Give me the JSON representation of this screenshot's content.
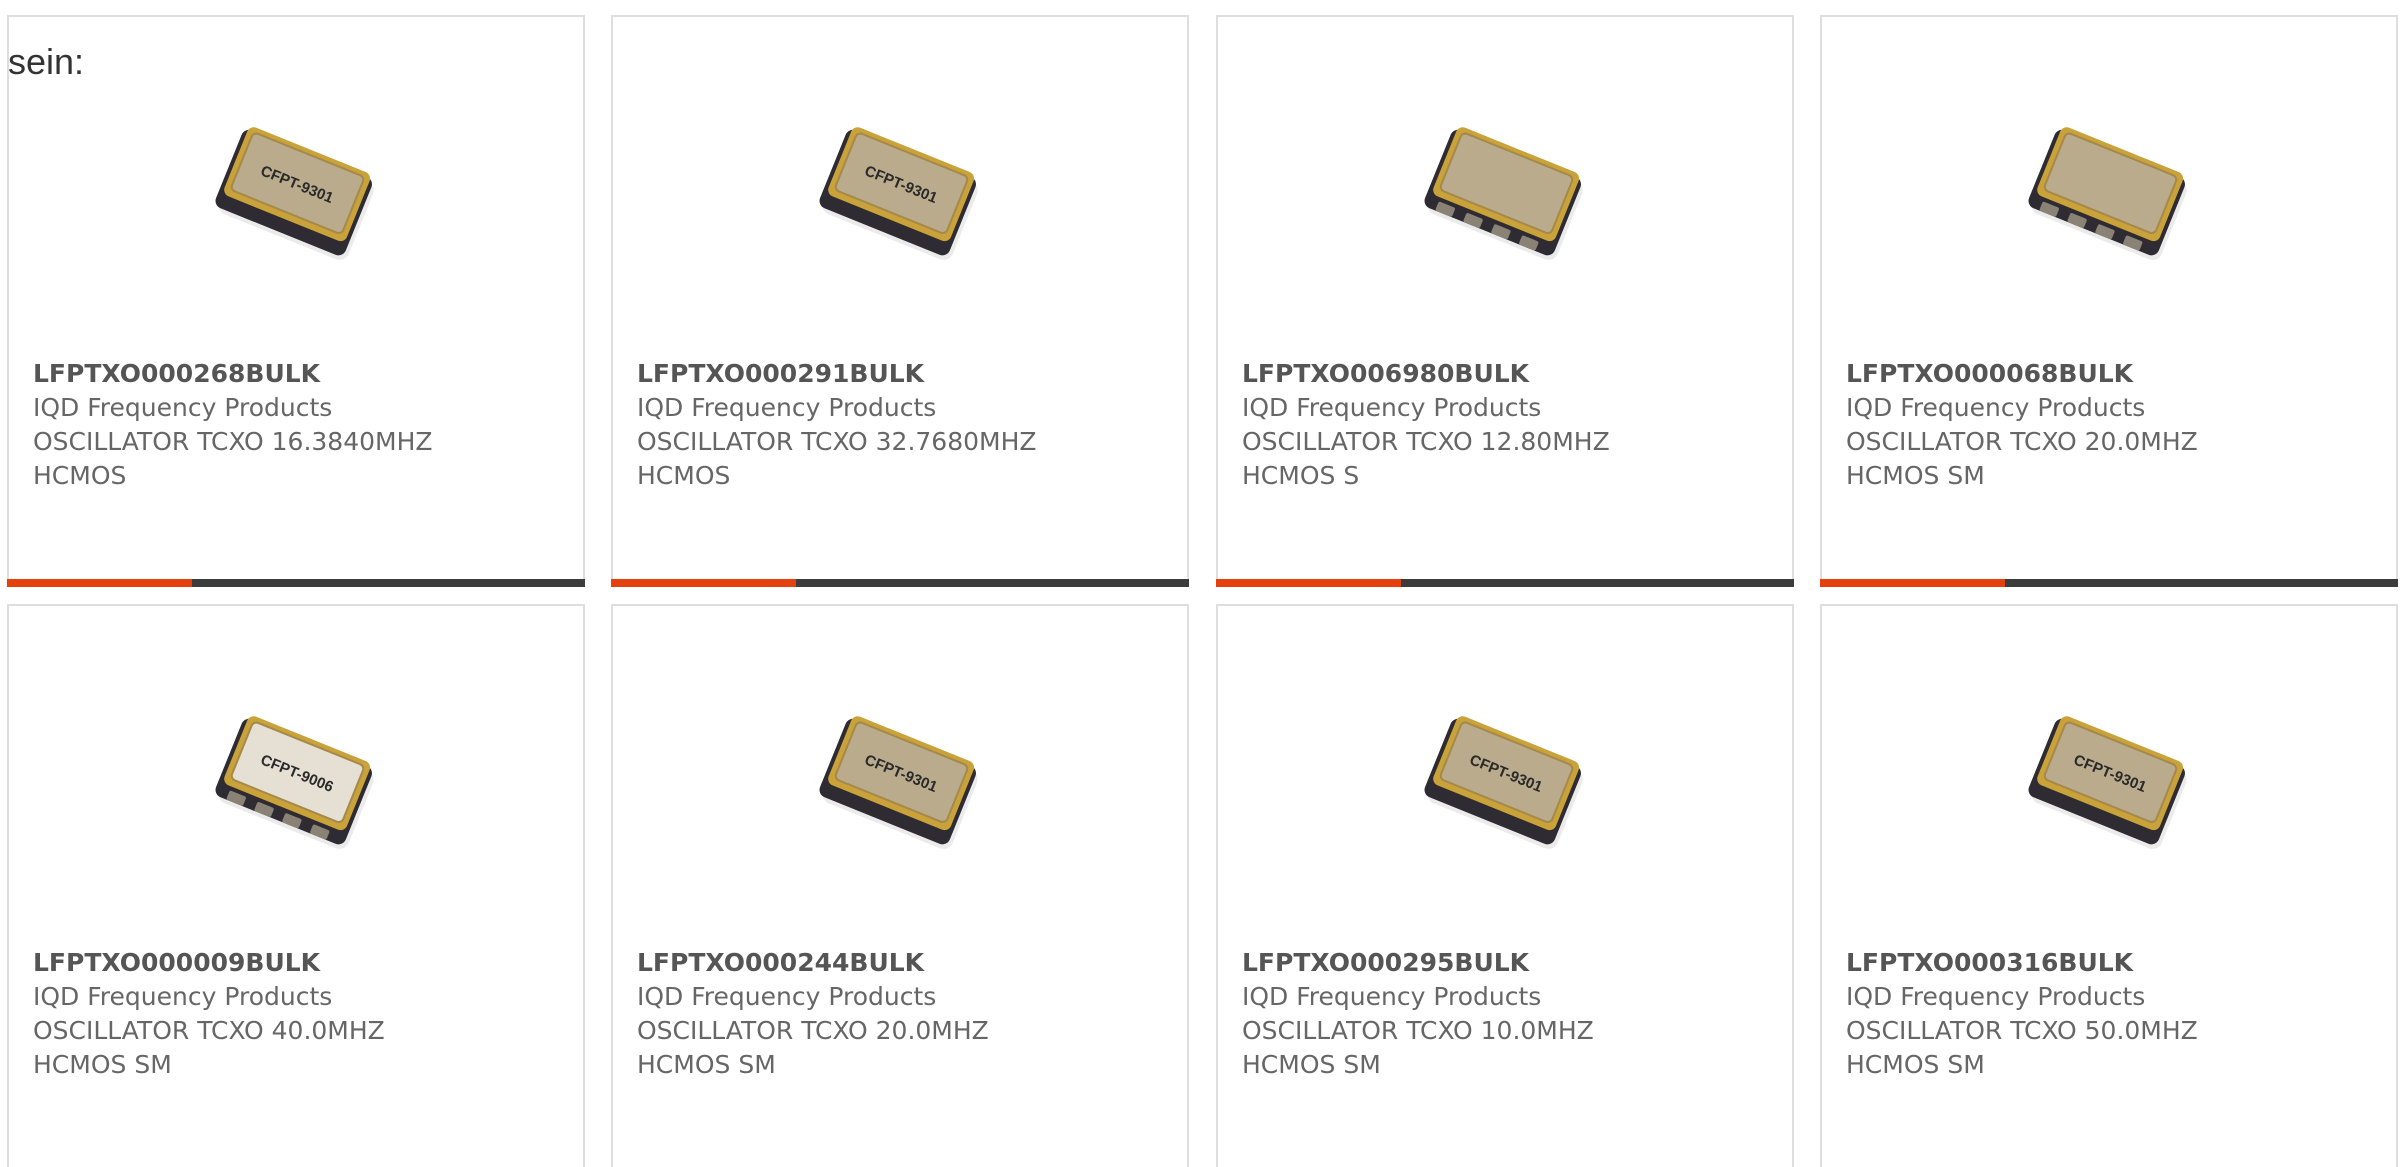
{
  "intro_text": "sein:",
  "colors": {
    "accent": "#e5410f",
    "bar_track": "#3c3c3c",
    "card_border": "#dedede",
    "text": "#666666"
  },
  "products": [
    {
      "part_number": "LFPTXO000268BULK",
      "manufacturer": "IQD Frequency Products",
      "description_line1": "OSCILLATOR TCXO 16.3840MHZ",
      "description_line2": "HCMOS",
      "image_label": "CFPT-9301",
      "image_type": "oscillator-chip-icon",
      "progress": 0.32
    },
    {
      "part_number": "LFPTXO000291BULK",
      "manufacturer": "IQD Frequency Products",
      "description_line1": "OSCILLATOR TCXO 32.7680MHZ",
      "description_line2": "HCMOS",
      "image_label": "CFPT-9301",
      "image_type": "oscillator-chip-icon",
      "progress": 0.32
    },
    {
      "part_number": "LFPTXO006980BULK",
      "manufacturer": "IQD Frequency Products",
      "description_line1": "OSCILLATOR TCXO 12.80MHZ",
      "description_line2": "HCMOS S",
      "image_label": "",
      "image_type": "oscillator-chip-icon",
      "progress": 0.32
    },
    {
      "part_number": "LFPTXO000068BULK",
      "manufacturer": "IQD Frequency Products",
      "description_line1": "OSCILLATOR TCXO 20.0MHZ",
      "description_line2": "HCMOS SM",
      "image_label": "",
      "image_type": "oscillator-chip-icon",
      "progress": 0.32
    },
    {
      "part_number": "LFPTXO000009BULK",
      "manufacturer": "IQD Frequency Products",
      "description_line1": "OSCILLATOR TCXO 40.0MHZ",
      "description_line2": "HCMOS SM",
      "image_label": "CFPT-9006",
      "image_type": "oscillator-chip-icon"
    },
    {
      "part_number": "LFPTXO000244BULK",
      "manufacturer": "IQD Frequency Products",
      "description_line1": "OSCILLATOR TCXO 20.0MHZ",
      "description_line2": "HCMOS SM",
      "image_label": "CFPT-9301",
      "image_type": "oscillator-chip-icon"
    },
    {
      "part_number": "LFPTXO000295BULK",
      "manufacturer": "IQD Frequency Products",
      "description_line1": "OSCILLATOR TCXO 10.0MHZ",
      "description_line2": "HCMOS SM",
      "image_label": "CFPT-9301",
      "image_type": "oscillator-chip-icon"
    },
    {
      "part_number": "LFPTXO000316BULK",
      "manufacturer": "IQD Frequency Products",
      "description_line1": "OSCILLATOR TCXO 50.0MHZ",
      "description_line2": "HCMOS SM",
      "image_label": "CFPT-9301",
      "image_type": "oscillator-chip-icon"
    }
  ]
}
